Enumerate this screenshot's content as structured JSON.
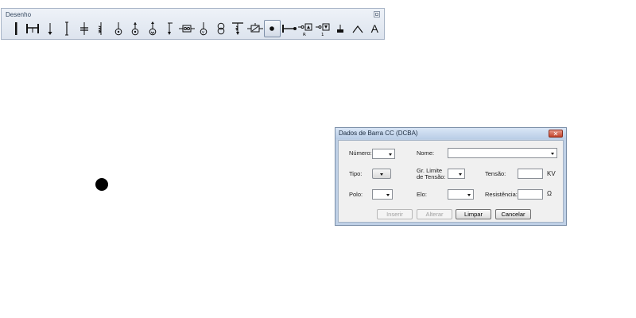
{
  "toolbar": {
    "title": "Desenho",
    "tools": [
      {
        "name": "bar-tool",
        "icon": "vertical-bar-icon"
      },
      {
        "name": "line-tool",
        "icon": "line-connector-icon"
      },
      {
        "name": "load-tool",
        "icon": "arrow-down-icon"
      },
      {
        "name": "double-terminal-tool",
        "icon": "vertical-line-icon"
      },
      {
        "name": "capacitor-tool",
        "icon": "capacitor-icon"
      },
      {
        "name": "reactor-tool",
        "icon": "reactor-icon"
      },
      {
        "name": "generator-tool",
        "icon": "generator-icon"
      },
      {
        "name": "synchronous-machine-tool",
        "icon": "synchronous-icon"
      },
      {
        "name": "motor-tool",
        "icon": "motor-icon"
      },
      {
        "name": "shunt-tool",
        "icon": "shunt-icon"
      },
      {
        "name": "converter-tool",
        "icon": "converter-icon"
      },
      {
        "name": "ground-tool",
        "icon": "ground-icon"
      },
      {
        "name": "transformer-tool",
        "icon": "transformer-icon"
      },
      {
        "name": "dc-link-tool",
        "icon": "dc-link-icon"
      },
      {
        "name": "hvdc-tool",
        "icon": "hvdc-converter-icon"
      },
      {
        "name": "dc-bus-tool",
        "icon": "dc-bus-icon",
        "active": true
      },
      {
        "name": "dc-line-tool",
        "icon": "dc-line-icon"
      },
      {
        "name": "rectifier-tool",
        "icon": "rectifier-icon",
        "caption": "R"
      },
      {
        "name": "inverter-tool",
        "icon": "inverter-icon",
        "caption": "1"
      },
      {
        "name": "dc-ground-tool",
        "icon": "dc-ground-icon"
      },
      {
        "name": "arc-tool",
        "icon": "arc-icon"
      },
      {
        "name": "text-tool",
        "icon": "text-icon",
        "text": "A"
      }
    ]
  },
  "dialog": {
    "title": "Dados de Barra CC (DCBA)",
    "close_symbol": "✕",
    "numero_label": "Número:",
    "nome_label": "Nome:",
    "tipo_label": "Tipo:",
    "gr_limite_label_1": "Gr. Limite",
    "gr_limite_label_2": "de Tensão:",
    "tensao_label": "Tensão:",
    "tensao_unit": "KV",
    "polo_label": "Polo:",
    "elo_label": "Elo:",
    "resistencia_label": "Resistência:",
    "resistencia_unit": "Ω",
    "numero_value": "",
    "nome_value": "",
    "tensao_value": "",
    "resistencia_value": "",
    "buttons": {
      "inserir": "Inserir",
      "alterar": "Alterar",
      "limpar": "Limpar",
      "cancelar": "Cancelar"
    }
  }
}
